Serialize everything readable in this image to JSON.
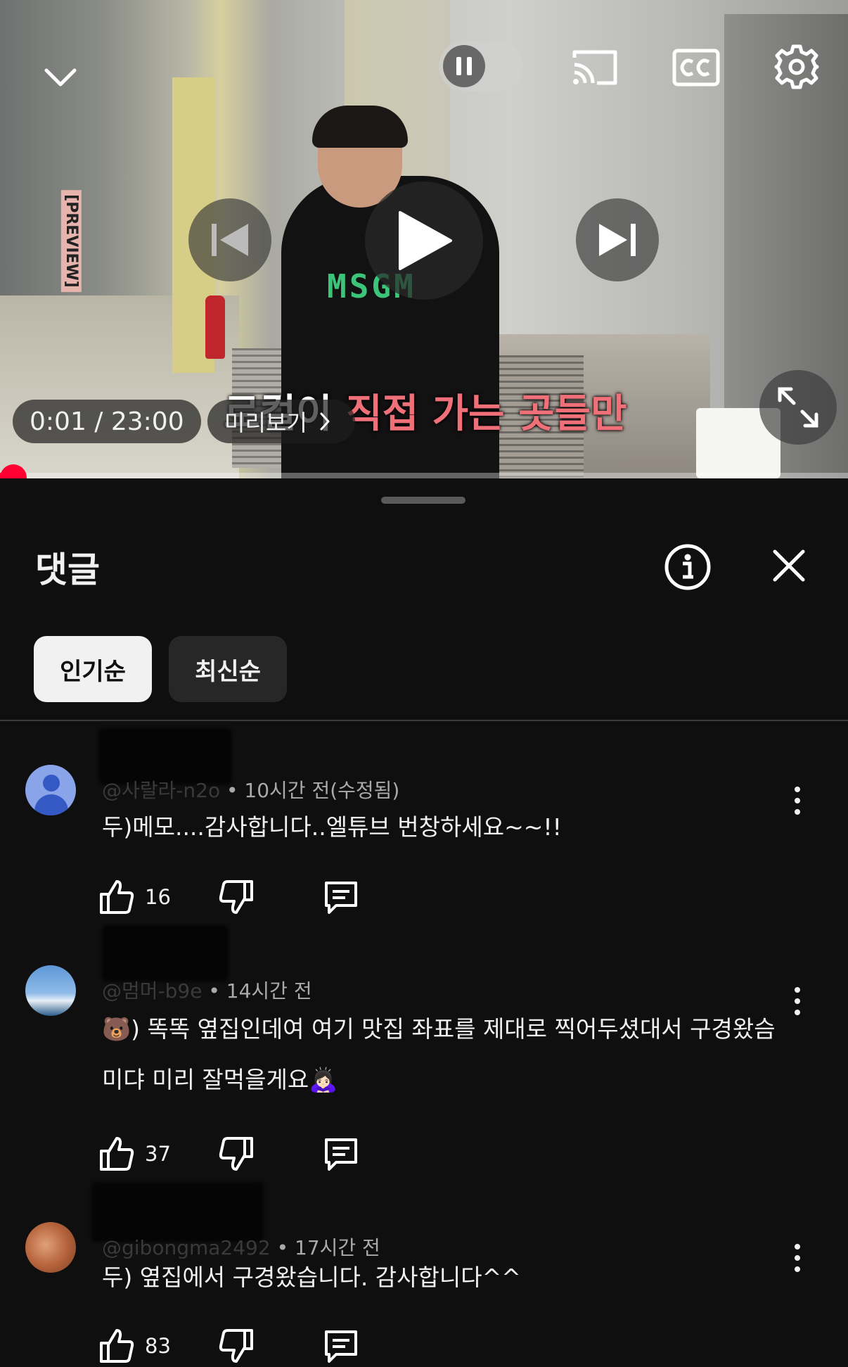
{
  "player": {
    "preview_tag": "[PREVIEW]",
    "shirt_logo": "MSGM",
    "subtitle_white": "로컬이 ",
    "subtitle_red": "직접 가는 곳들만",
    "time": "0:01 / 23:00",
    "preview_label": "미리보기",
    "progress_fraction": 0.0007,
    "icons": [
      "chevron-down-icon",
      "pause-icon",
      "cast-icon",
      "cc-icon",
      "gear-icon",
      "skip-previous-icon",
      "play-icon",
      "skip-next-icon",
      "fullscreen-icon",
      "chevron-right-icon"
    ]
  },
  "comments_panel": {
    "title": "댓글",
    "sort_chips": [
      "인기순",
      "최신순"
    ],
    "active_chip": "인기순",
    "comments": [
      {
        "handle": "@사랄라-n2o",
        "time": "10시간 전(수정됨)",
        "text": "두)메모....감사합니다..엘튜브 번창하세요~~!!",
        "likes": "16",
        "avatar": "default"
      },
      {
        "handle": "@멈머-b9e",
        "time": "14시간 전",
        "text": "🐻) 똑똑 옆집인데여 여기 맛집 좌표를 제대로 찍어두셨대서 구경왔슴미댜 미리 잘먹을게요🙇🏻‍♀️",
        "likes": "37",
        "avatar": "sky"
      },
      {
        "handle": "@gibongma2492",
        "time": "17시간 전",
        "text": "두) 옆집에서 구경왔습니다. 감사합니다^^",
        "likes": "83",
        "avatar": "food"
      }
    ]
  },
  "colors": {
    "accent": "#ff0033",
    "background": "#0f0f0f",
    "chip_active": "#f1f1f1",
    "chip_inactive": "#272727",
    "subtitle_red": "#f0707a"
  }
}
